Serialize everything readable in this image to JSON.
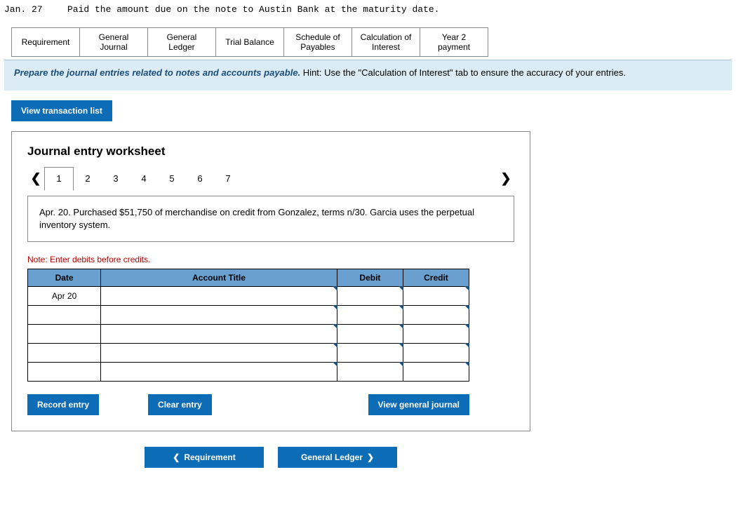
{
  "top": {
    "date": "Jan.   27",
    "text": "Paid the amount due on the note to Austin Bank at the maturity date."
  },
  "tabs": [
    "Requirement",
    "General\nJournal",
    "General\nLedger",
    "Trial Balance",
    "Schedule of\nPayables",
    "Calculation of\nInterest",
    "Year 2\npayment"
  ],
  "hint": {
    "prep": "Prepare the journal entries related to notes and accounts payable.",
    "rest": "  Hint:  Use the \"Calculation of Interest\" tab to ensure the accuracy of your entries."
  },
  "vtl": "View transaction list",
  "panel": {
    "title": "Journal entry worksheet",
    "pages": [
      "1",
      "2",
      "3",
      "4",
      "5",
      "6",
      "7"
    ],
    "active": 0,
    "desc": "Apr. 20. Purchased $51,750 of merchandise on credit from Gonzalez, terms n/30. Garcia uses the perpetual inventory system.",
    "note": "Note: Enter debits before credits.",
    "headers": {
      "date": "Date",
      "account": "Account Title",
      "debit": "Debit",
      "credit": "Credit"
    },
    "rows": [
      {
        "date": "Apr 20",
        "account": "",
        "debit": "",
        "credit": ""
      },
      {
        "date": "",
        "account": "",
        "debit": "",
        "credit": ""
      },
      {
        "date": "",
        "account": "",
        "debit": "",
        "credit": ""
      },
      {
        "date": "",
        "account": "",
        "debit": "",
        "credit": ""
      },
      {
        "date": "",
        "account": "",
        "debit": "",
        "credit": ""
      }
    ],
    "buttons": {
      "record": "Record entry",
      "clear": "Clear entry",
      "view": "View general journal"
    }
  },
  "bottom": {
    "prev": "Requirement",
    "next": "General Ledger"
  }
}
